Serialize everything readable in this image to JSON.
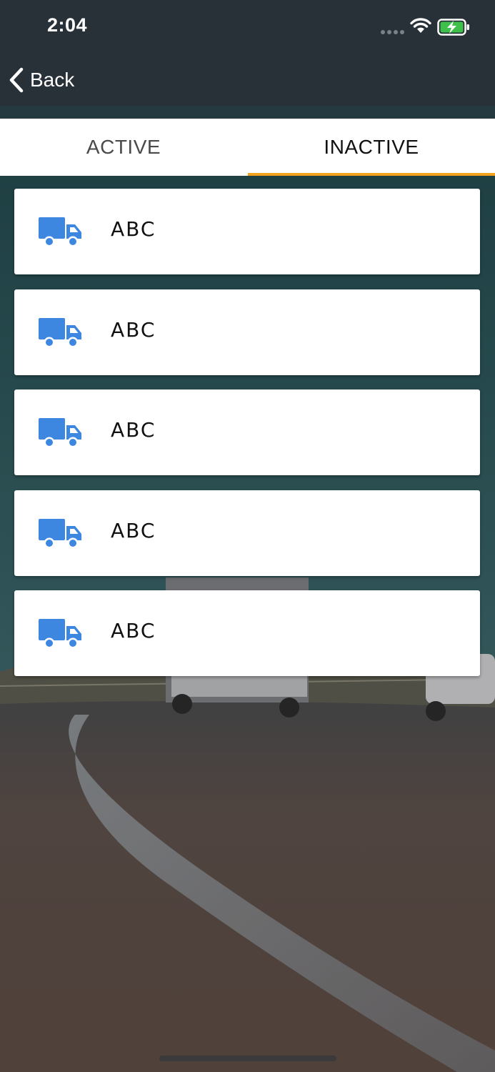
{
  "status_bar": {
    "time": "2:04"
  },
  "nav": {
    "back_label": "Back"
  },
  "tabs": [
    {
      "label": "ACTIVE",
      "selected": false
    },
    {
      "label": "INACTIVE",
      "selected": true
    }
  ],
  "vehicles": [
    {
      "name": "ABC",
      "icon": "truck-icon"
    },
    {
      "name": "ABC",
      "icon": "truck-icon"
    },
    {
      "name": "ABC",
      "icon": "truck-icon"
    },
    {
      "name": "ABC",
      "icon": "truck-icon"
    },
    {
      "name": "ABC",
      "icon": "truck-icon"
    }
  ],
  "colors": {
    "header": "#283038",
    "accent": "#f2a31d",
    "truck": "#3d87e0",
    "battery": "#3ec04a"
  }
}
